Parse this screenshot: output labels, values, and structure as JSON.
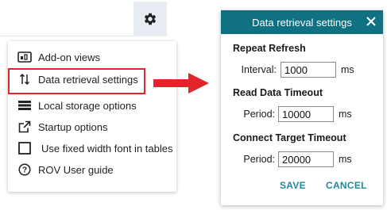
{
  "menu": {
    "items": [
      {
        "label": "Add-on views",
        "icon": "addon-views-icon"
      },
      {
        "label": "Data retrieval settings",
        "icon": "sort-arrows-icon"
      },
      {
        "label": "Local storage options",
        "icon": "storage-icon"
      },
      {
        "label": "Startup options",
        "icon": "external-link-icon"
      },
      {
        "label": "Use fixed width font in tables",
        "icon": "checkbox-icon"
      },
      {
        "label": "ROV User guide",
        "icon": "help-circle-icon"
      }
    ]
  },
  "dialog": {
    "title": "Data retrieval settings",
    "sections": [
      {
        "title": "Repeat Refresh",
        "field_label": "Interval:",
        "value": "1000",
        "unit": "ms"
      },
      {
        "title": "Read Data Timeout",
        "field_label": "Period:",
        "value": "10000",
        "unit": "ms"
      },
      {
        "title": "Connect Target Timeout",
        "field_label": "Period:",
        "value": "20000",
        "unit": "ms"
      }
    ],
    "save_label": "SAVE",
    "cancel_label": "CANCEL"
  },
  "colors": {
    "header": "#0f7182",
    "highlight": "#e0252b",
    "button_text": "#1e8aa0"
  }
}
